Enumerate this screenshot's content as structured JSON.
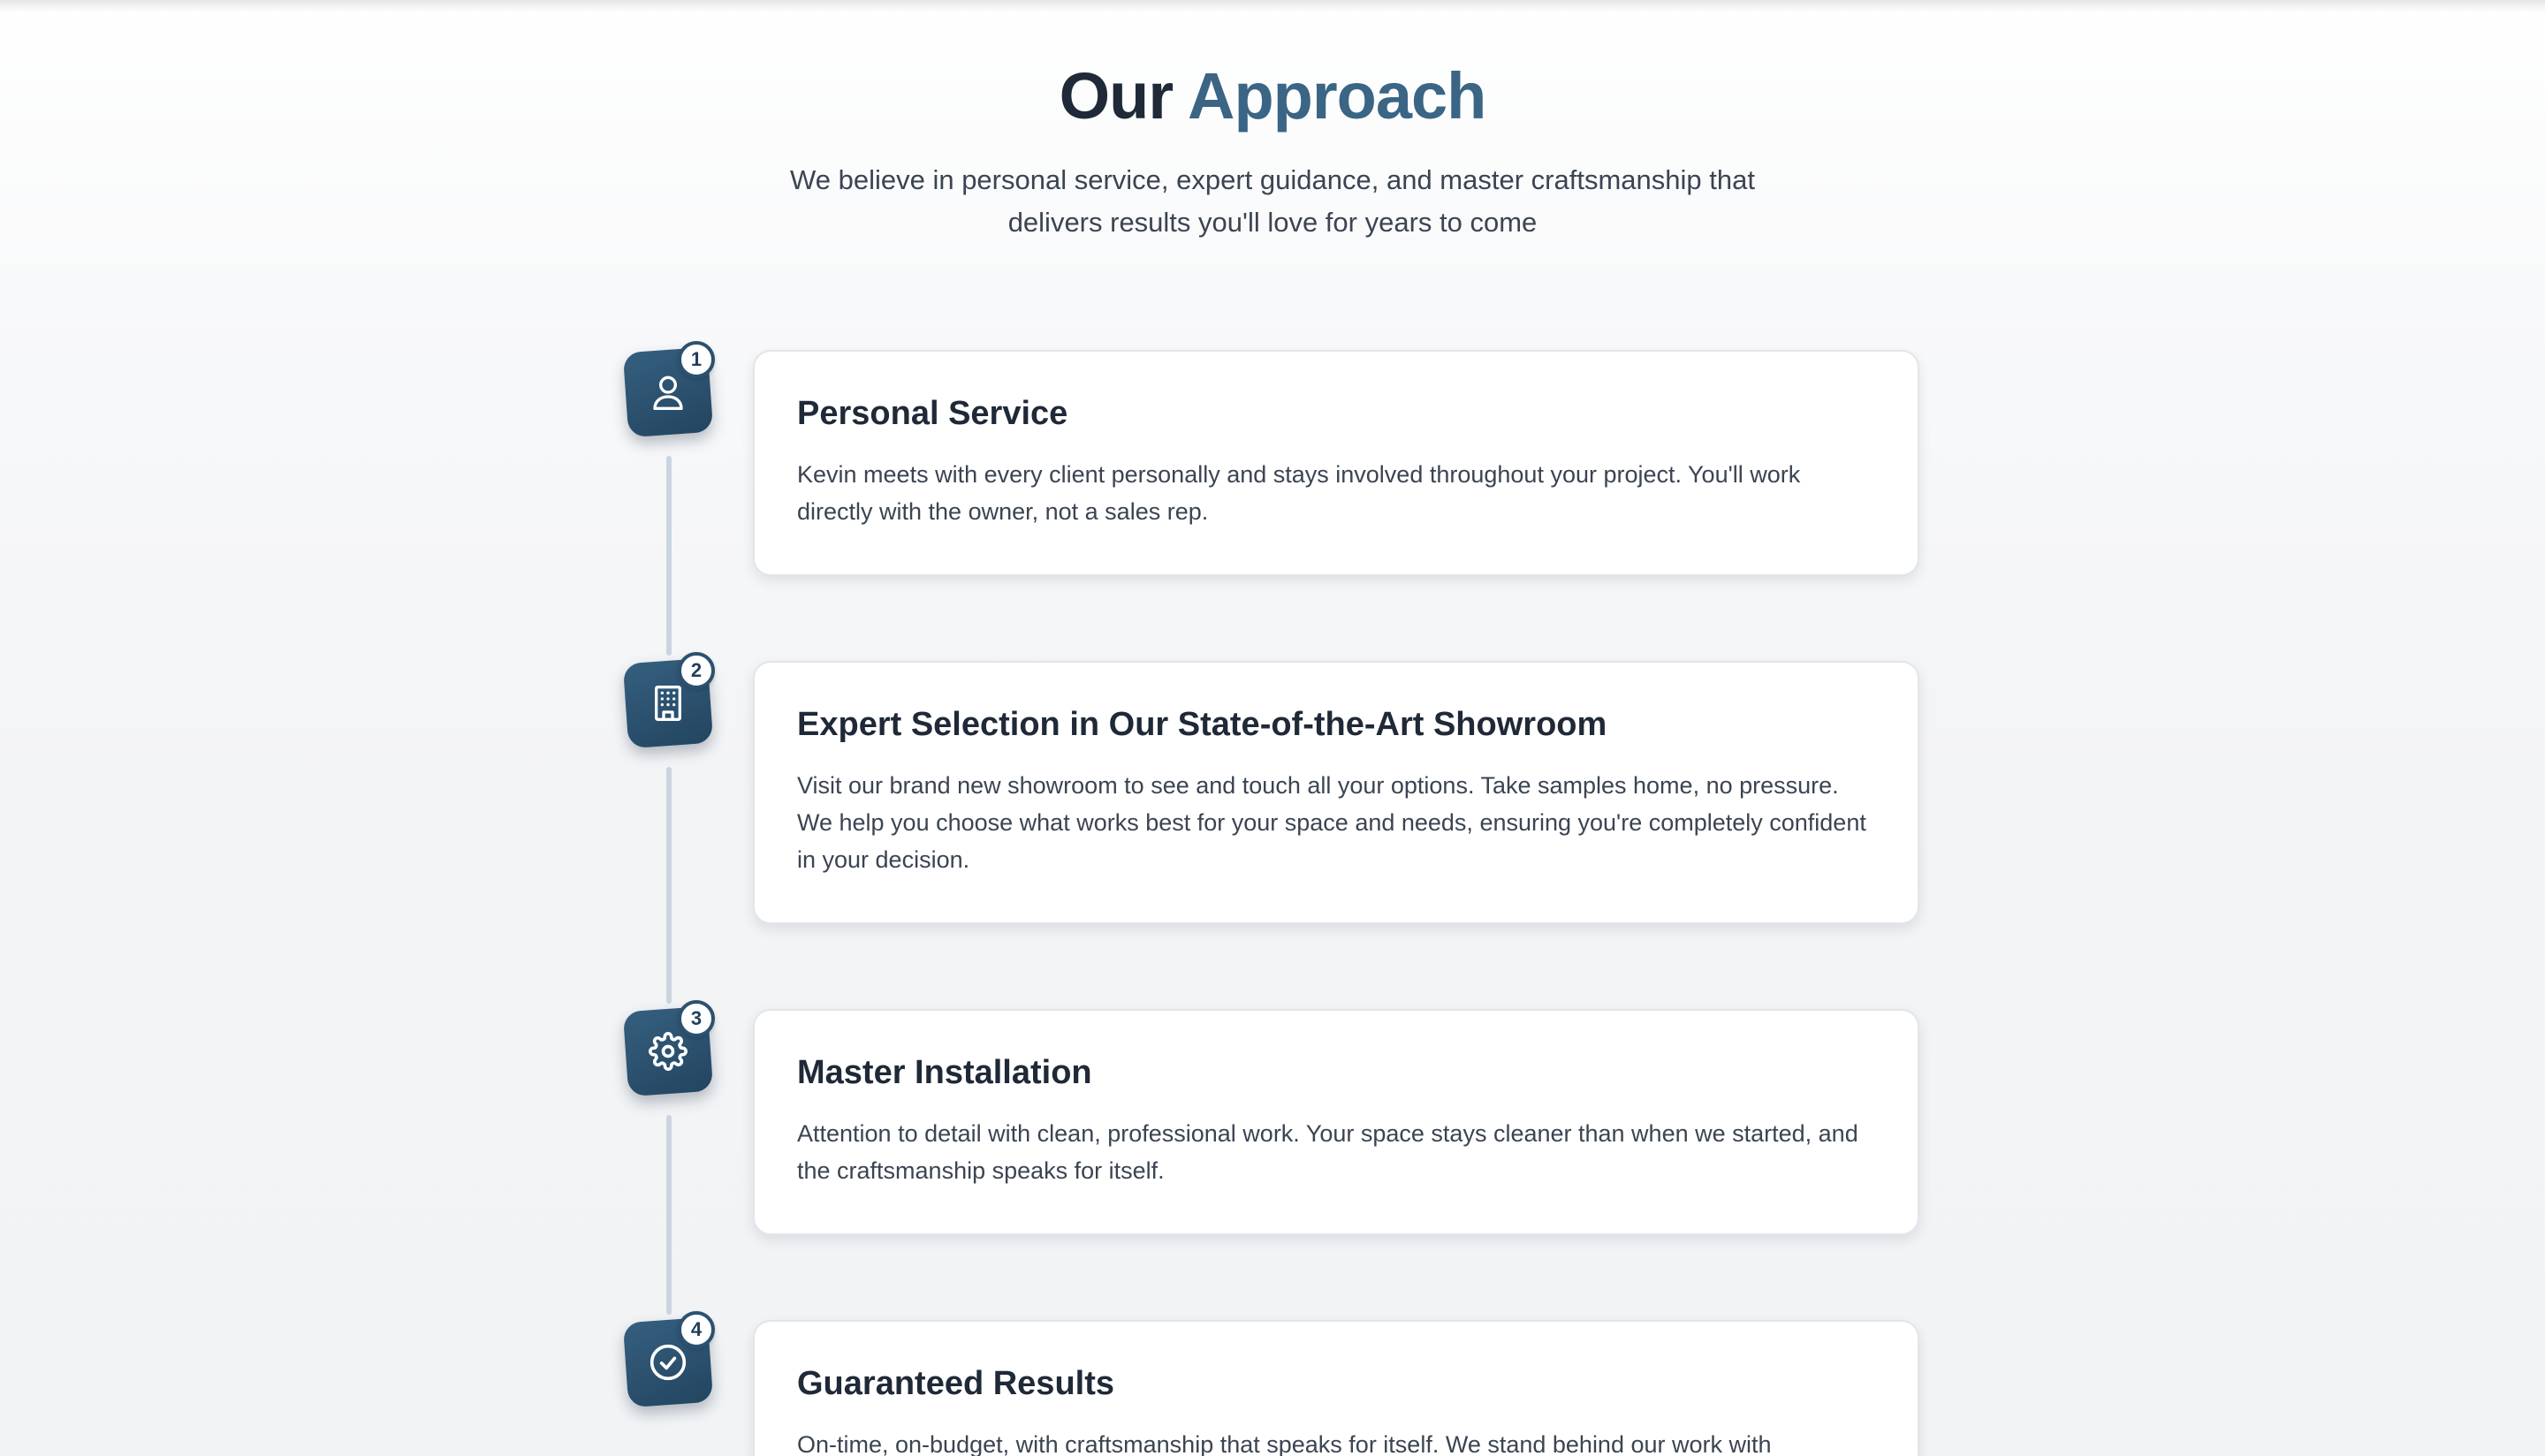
{
  "header": {
    "title_part1": "Our",
    "title_part2": "Approach",
    "subtitle": "We believe in personal service, expert guidance, and master craftsmanship that delivers results you'll love for years to come"
  },
  "colors": {
    "accent": "#3a6585",
    "icon_background": "#2c5170",
    "timeline_line": "#cbd5df"
  },
  "steps": [
    {
      "number": "1",
      "icon": "user-icon",
      "title": "Personal Service",
      "description": "Kevin meets with every client personally and stays involved throughout your project. You'll work directly with the owner, not a sales rep."
    },
    {
      "number": "2",
      "icon": "building-icon",
      "title": "Expert Selection in Our State-of-the-Art Showroom",
      "description": "Visit our brand new showroom to see and touch all your options. Take samples home, no pressure. We help you choose what works best for your space and needs, ensuring you're completely confident in your decision."
    },
    {
      "number": "3",
      "icon": "gear-icon",
      "title": "Master Installation",
      "description": "Attention to detail with clean, professional work. Your space stays cleaner than when we started, and the craftsmanship speaks for itself."
    },
    {
      "number": "4",
      "icon": "check-circle-icon",
      "title": "Guaranteed Results",
      "description": "On-time, on-budget, with craftsmanship that speaks for itself. We stand behind our work with"
    }
  ]
}
